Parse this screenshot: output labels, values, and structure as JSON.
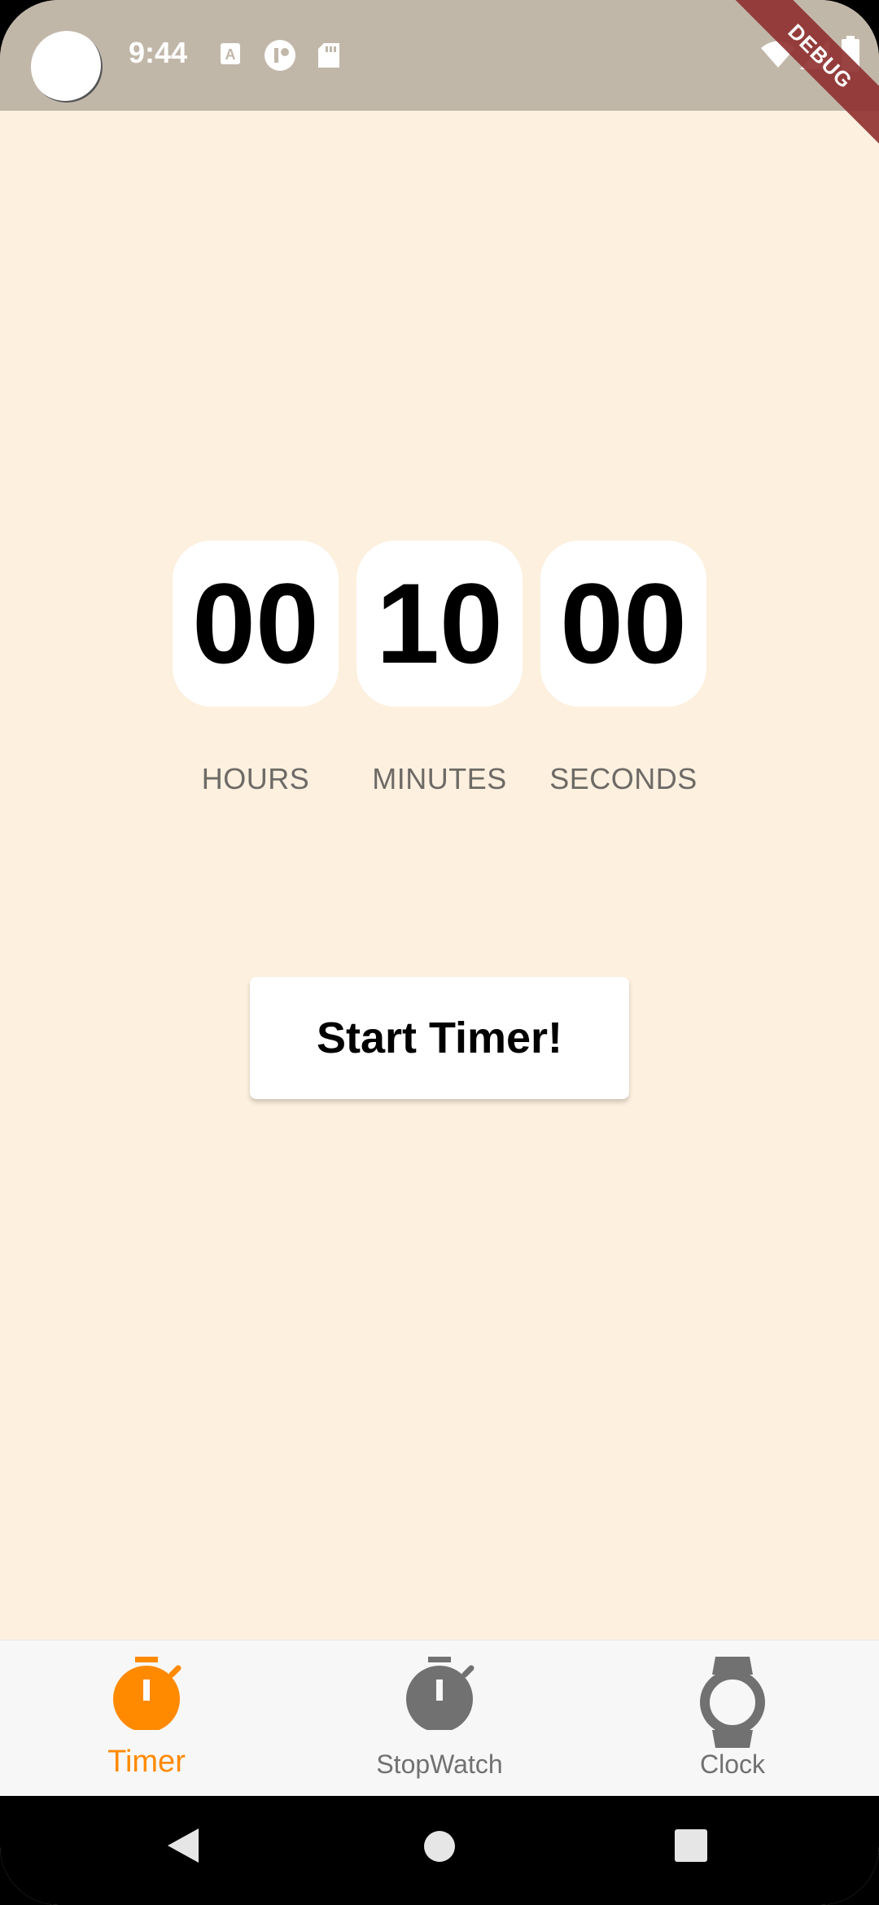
{
  "status_bar": {
    "time": "9:44",
    "icons": [
      "text-a-icon",
      "app-badge-icon",
      "sd-card-icon",
      "wifi-icon",
      "signal-icon",
      "battery-icon"
    ],
    "debug_banner": "DEBUG"
  },
  "timer": {
    "hours": "00",
    "minutes": "10",
    "seconds": "00",
    "hours_label": "HOURS",
    "minutes_label": "MINUTES",
    "seconds_label": "SECONDS"
  },
  "start_button_label": "Start Timer!",
  "bottom_nav": {
    "active_color": "#FF8A00",
    "inactive_color": "#717171",
    "items": [
      {
        "label": "Timer",
        "icon": "timer-icon",
        "active": true
      },
      {
        "label": "StopWatch",
        "icon": "stopwatch-icon",
        "active": false
      },
      {
        "label": "Clock",
        "icon": "watch-icon",
        "active": false
      }
    ]
  },
  "colors": {
    "background": "#FDF0DF",
    "status_bar": "#C1B7A9",
    "debug_banner": "#8E2F2F"
  }
}
